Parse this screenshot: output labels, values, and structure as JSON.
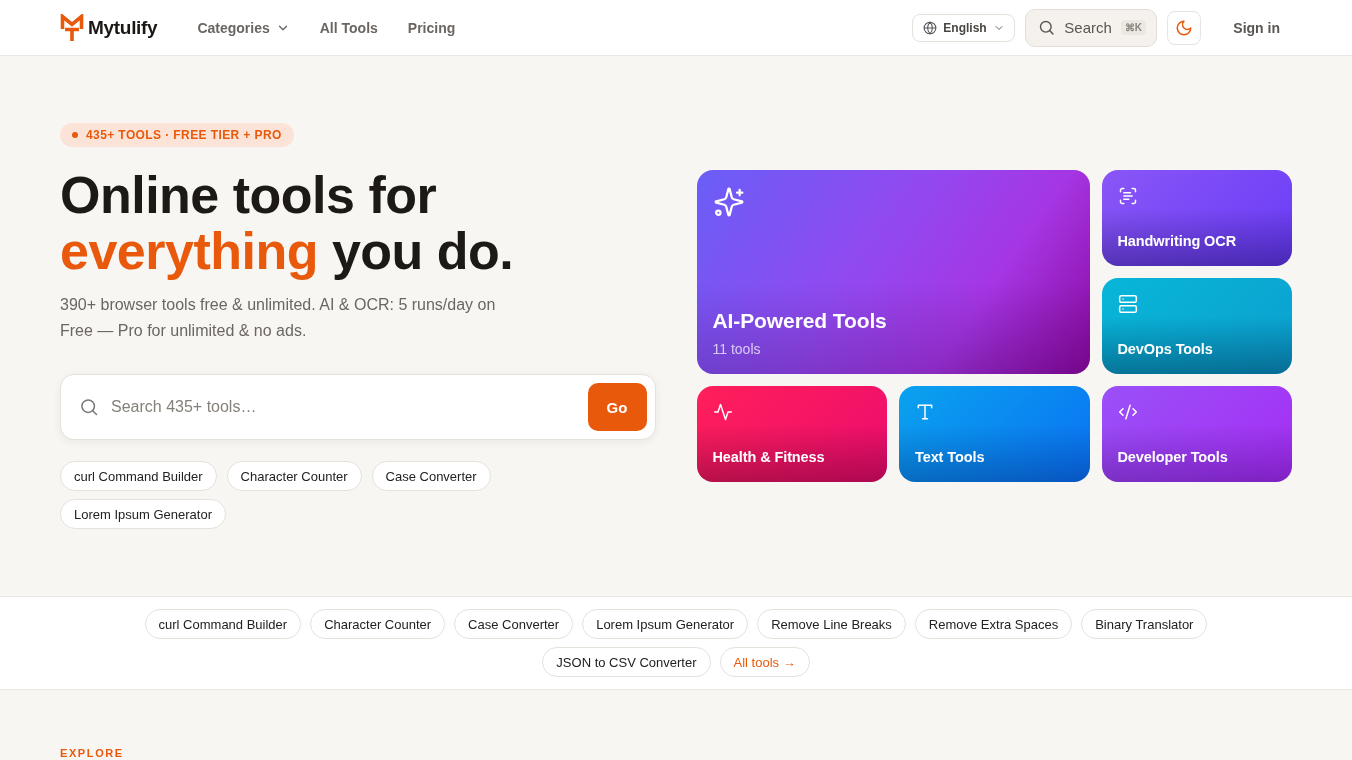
{
  "header": {
    "brand": "Mytulify",
    "nav": [
      {
        "label": "Categories",
        "has_menu": true
      },
      {
        "label": "All Tools",
        "has_menu": false
      },
      {
        "label": "Pricing",
        "has_menu": false
      }
    ],
    "language": {
      "value": "English"
    },
    "search": {
      "label": "Search",
      "shortcut": "⌘K"
    },
    "sign_in": "Sign in"
  },
  "hero": {
    "badge": "435+ TOOLS · FREE TIER + PRO",
    "headline": {
      "text": "Online tools for",
      "accent": "everything",
      "after": "you do."
    },
    "subtitle": "390+ browser tools free & unlimited. AI & OCR: 5 runs/day on Free — Pro for unlimited & no ads.",
    "search": {
      "placeholder": "Search 435+ tools…",
      "button": "Go"
    },
    "popular_tools": [
      "curl Command Builder",
      "Character Counter",
      "Case Converter",
      "Lorem Ipsum Generator"
    ],
    "categories": [
      {
        "title": "AI-Powered Tools",
        "count": "11 tools",
        "kind": "ai",
        "featured": true
      },
      {
        "title": "Handwriting OCR",
        "kind": "ocr",
        "featured": false
      },
      {
        "title": "DevOps Tools",
        "kind": "devops",
        "featured": false
      },
      {
        "title": "Health & Fitness",
        "kind": "health",
        "featured": false
      },
      {
        "title": "Text Tools",
        "kind": "text",
        "featured": false
      },
      {
        "title": "Developer Tools",
        "kind": "code",
        "featured": false
      }
    ]
  },
  "tool_strip": {
    "tools": [
      "curl Command Builder",
      "Character Counter",
      "Case Converter",
      "Lorem Ipsum Generator",
      "Remove Line Breaks",
      "Remove Extra Spaces",
      "Binary Translator",
      "JSON to CSV Converter"
    ],
    "all_tools_link": "All tools →"
  },
  "explore": {
    "eyebrow": "EXPLORE"
  }
}
